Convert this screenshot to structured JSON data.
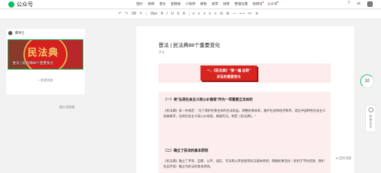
{
  "nav": {
    "brand": "公众号",
    "menu": [
      "图片",
      "视频",
      "音乐",
      "超链接",
      "小程序",
      "模板",
      "投票",
      "搜索",
      "整理位置",
      "视频号",
      "公众号"
    ],
    "right_icons": [
      "help-icon",
      "message-icon",
      "avatar"
    ]
  },
  "toolbar": {
    "items": [
      "↶",
      "↷",
      "⌫",
      "✎",
      "15px",
      "B",
      "I",
      "U",
      "S",
      "A",
      "≡",
      "≡",
      "≡",
      "≡",
      "≡",
      "⊟",
      "⊞",
      "—",
      "⟷",
      "<>",
      "⊚"
    ]
  },
  "left_panel": {
    "author": "麒律士",
    "cover_title": "民法典",
    "cover_caption": "普法 | 民法典88个重要变化",
    "add_article": "+ 新建消息",
    "below_link": "图片说明素"
  },
  "editor": {
    "title": "普法 | 民法典88个重要变化",
    "author": "于以",
    "banner": {
      "line1": "一、《民法典》\"第一编 总则\"",
      "line2": "涉及的重要变化"
    },
    "section1_title": "（一）将\"弘扬社会主义核心价值观\"作为一项重要立法目的",
    "section1_text": "《民法典》第一条规定：\"为了保护民事主体的合法权益，调整民事关系，维护社会和经济秩序，适应中国特色社会主义发展要求，弘扬社会主义核心价值观，根据宪法，制定《民法典》。\"",
    "section2_title": "（二）确立了民法的基本原则",
    "section2_text": "《民法典》确立了平等、自愿、公平、诚信、守法和公序良俗等民法基本原则；明确民事活动（有利于节约资源、保护生态环境）确立为民法的基本原则。"
  },
  "widgets": {
    "word_count": "32",
    "checker_label": "检查全文",
    "back_to_top": "回到顶部"
  }
}
